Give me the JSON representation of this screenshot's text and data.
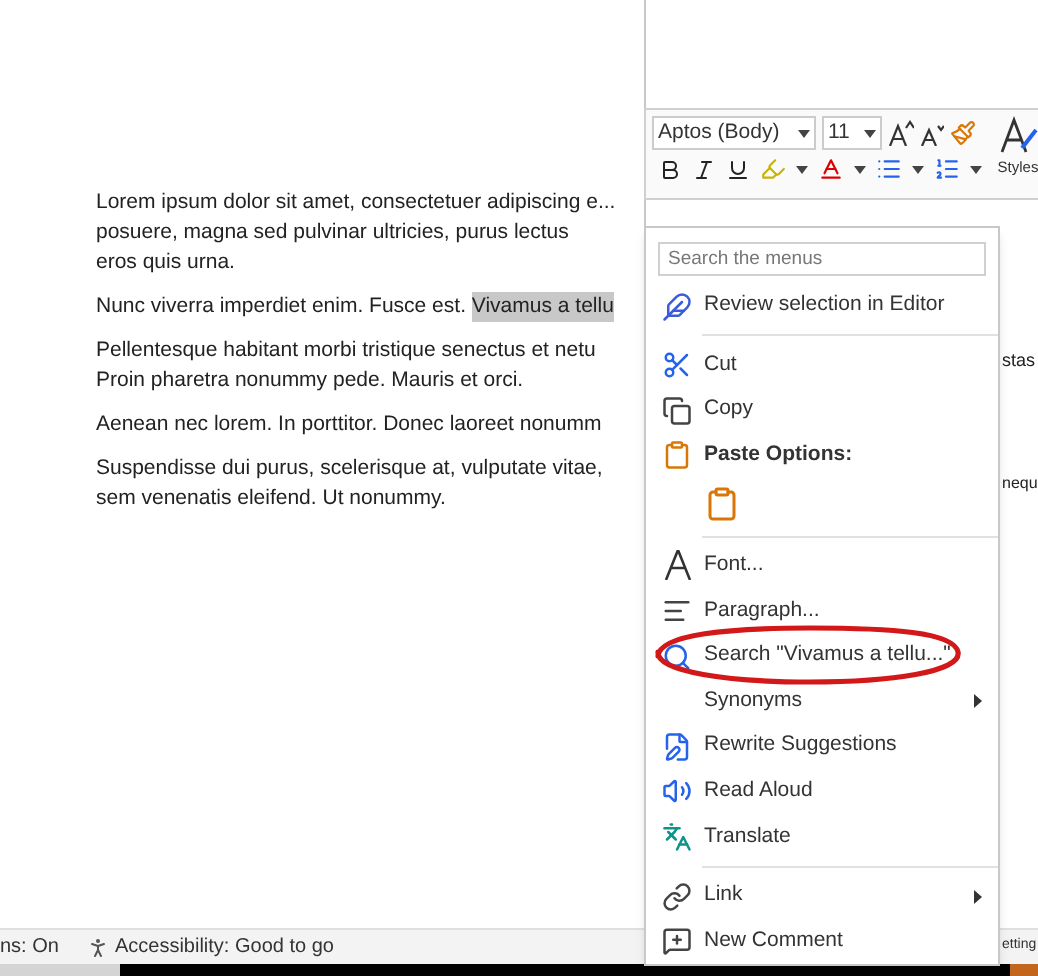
{
  "document": {
    "paragraphs": [
      {
        "lines": [
          "Lorem ipsum dolor sit amet, consectetuer adipiscing e...",
          "posuere, magna sed pulvinar ultricies, purus lectus",
          "eros quis urna."
        ]
      },
      {
        "lines": [
          "Nunc viverra imperdiet enim. Fusce est. "
        ],
        "selection": "Vivamus a tellu"
      },
      {
        "lines": [
          "Pellentesque habitant morbi tristique senectus et netu",
          "Proin pharetra nonummy pede. Mauris et orci."
        ],
        "overflow": "stas"
      },
      {
        "lines": [
          "Aenean nec lorem. In porttitor. Donec laoreet nonumm"
        ]
      },
      {
        "lines": [
          "Suspendisse dui purus, scelerisque at, vulputate vitae,",
          "sem venenatis eleifend. Ut nonummy."
        ],
        "overflow": "nequ"
      }
    ]
  },
  "mini_toolbar": {
    "font": "Aptos (Body)",
    "size": "11",
    "styles_label": "Styles"
  },
  "context_menu": {
    "search": {
      "placeholder": "Search the menus"
    },
    "items": [
      {
        "kind": "item",
        "label": "Review selection in Editor",
        "submenu": false
      },
      {
        "kind": "divider"
      },
      {
        "kind": "item",
        "label": "Cut",
        "submenu": false
      },
      {
        "kind": "item",
        "label": "Copy",
        "submenu": false
      },
      {
        "kind": "header",
        "label": "Paste Options:"
      },
      {
        "kind": "paste-option"
      },
      {
        "kind": "divider"
      },
      {
        "kind": "item",
        "label": "Font...",
        "submenu": false
      },
      {
        "kind": "item",
        "label": "Paragraph...",
        "submenu": false
      },
      {
        "kind": "item",
        "label": "Search \"Vivamus a tellu...\"",
        "submenu": false
      },
      {
        "kind": "item",
        "label": "Synonyms",
        "submenu": true
      },
      {
        "kind": "item",
        "label": "Rewrite Suggestions",
        "submenu": false
      },
      {
        "kind": "item",
        "label": "Read Aloud",
        "submenu": false
      },
      {
        "kind": "item",
        "label": "Translate",
        "submenu": false
      },
      {
        "kind": "divider"
      },
      {
        "kind": "item",
        "label": "Link",
        "submenu": true
      },
      {
        "kind": "item",
        "label": "New Comment",
        "submenu": false
      }
    ]
  },
  "status_bar": {
    "left": "ns: On",
    "accessibility": "Accessibility: Good to go",
    "right": "etting"
  }
}
